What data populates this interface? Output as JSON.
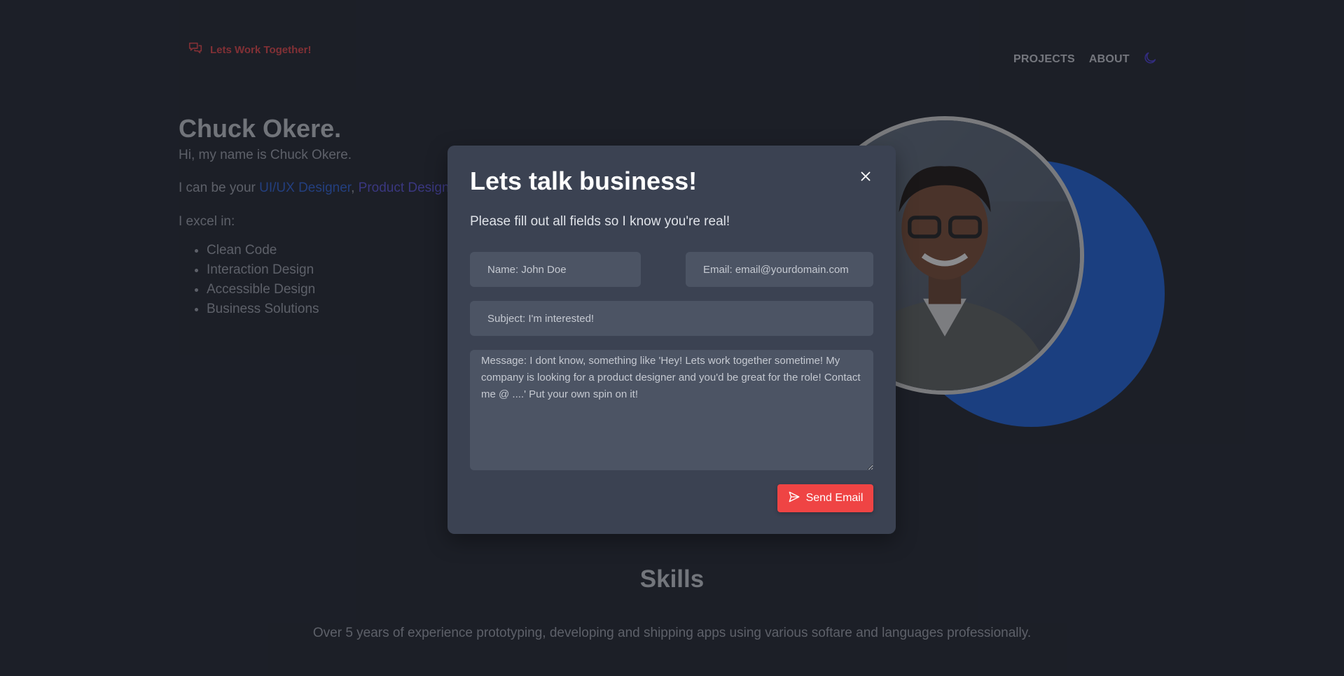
{
  "header": {
    "work_link_label": "Lets Work Together!",
    "nav": [
      "PROJECTS",
      "ABOUT"
    ]
  },
  "hero": {
    "title": "Chuck Okere.",
    "intro": "Hi, my name is Chuck Okere.",
    "roles_prefix": "I can be your ",
    "role_1": "UI/UX Designer",
    "roles_sep": ", ",
    "role_2": "Product Designer",
    "excel_label": "I excel in:",
    "skills": [
      "Clean Code",
      "Interaction Design",
      "Accessible Design",
      "Business Solutions"
    ]
  },
  "modal": {
    "title": "Lets talk business!",
    "subtitle": "Please fill out all fields so I know you're real!",
    "name_placeholder": "Name: John Doe",
    "email_placeholder": "Email: email@yourdomain.com",
    "subject_placeholder": "Subject: I'm interested!",
    "message_placeholder": "Message: I dont know, something like 'Hey! Lets work together sometime! My company is looking for a product designer and you'd be great for the role! Contact me @ ....' Put your own spin on it!",
    "send_label": "Send Email"
  },
  "skills_section": {
    "title": "Skills",
    "description": "Over 5 years of experience prototyping, developing and shipping apps using various softare and languages professionally."
  },
  "icons": {
    "work_link": "chat-bubbles-icon",
    "theme_toggle": "moon-icon",
    "close": "close-icon",
    "send": "paper-plane-icon"
  },
  "colors": {
    "background": "#21252f",
    "modal": "#3b4252",
    "accent_red": "#ef4444",
    "role_blue": "#2f62d6",
    "role_purple": "#5a54d8",
    "circle_blue": "#1f63d8"
  }
}
